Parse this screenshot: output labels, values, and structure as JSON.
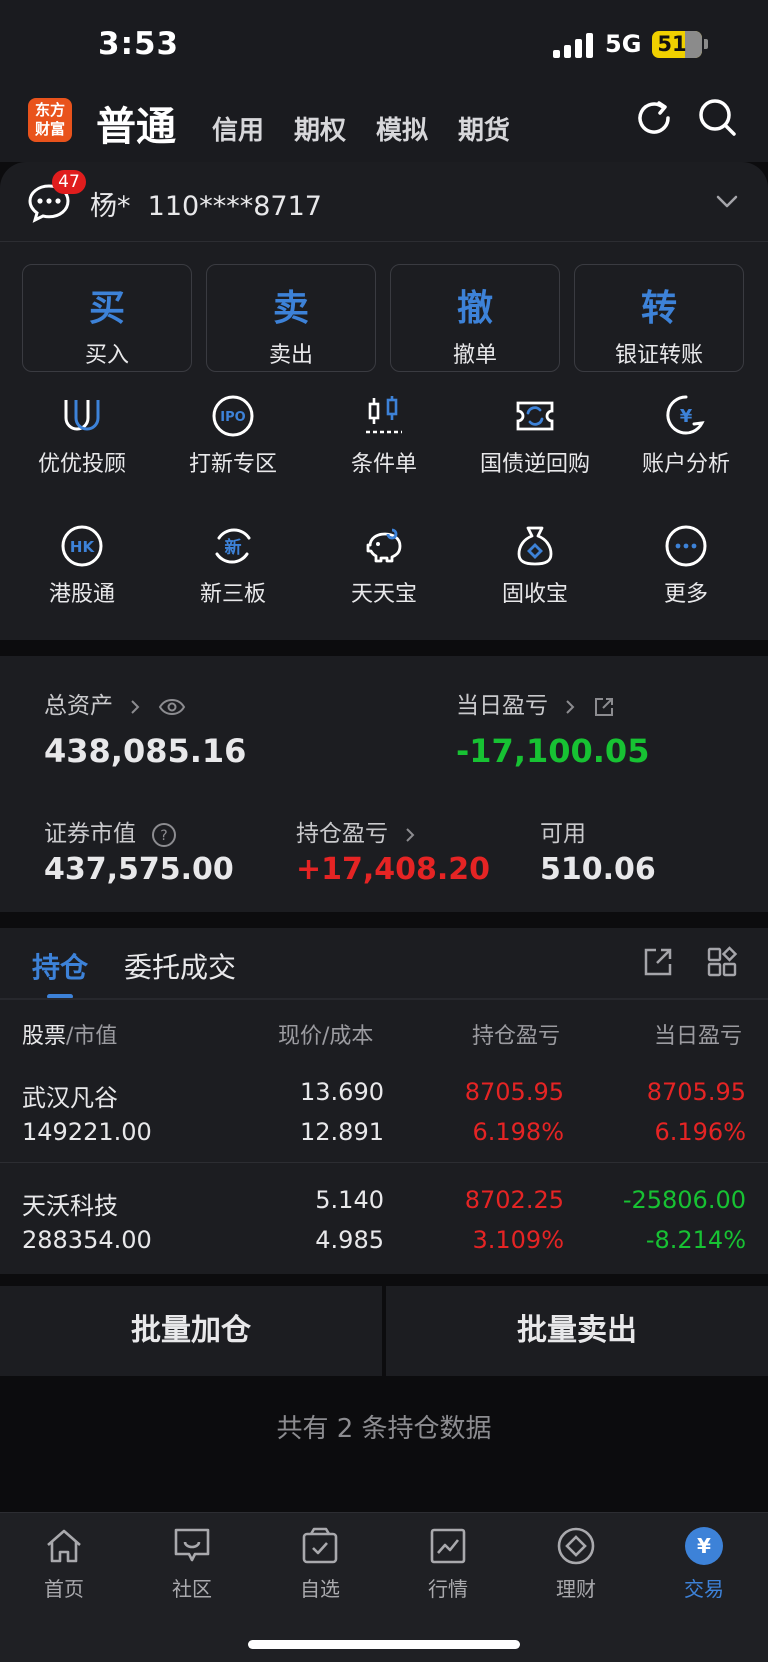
{
  "status": {
    "time": "3:53",
    "network": "5G",
    "battery": "51"
  },
  "header": {
    "logo": [
      "东方",
      "财富"
    ],
    "active_tab": "普通",
    "tabs": [
      "信用",
      "期权",
      "模拟",
      "期货"
    ]
  },
  "account": {
    "unread": "47",
    "name": "杨*",
    "number": "110****8717"
  },
  "trade_buttons": [
    {
      "big": "买",
      "small": "买入"
    },
    {
      "big": "卖",
      "small": "卖出"
    },
    {
      "big": "撤",
      "small": "撤单"
    },
    {
      "big": "转",
      "small": "银证转账"
    }
  ],
  "services": [
    {
      "label": "优优投顾",
      "icon": "youyou-icon"
    },
    {
      "label": "打新专区",
      "icon": "ipo-icon",
      "glyph": "IPO"
    },
    {
      "label": "条件单",
      "icon": "condition-order-icon"
    },
    {
      "label": "国债逆回购",
      "icon": "repo-icon"
    },
    {
      "label": "账户分析",
      "icon": "account-analysis-icon",
      "glyph": "¥"
    },
    {
      "label": "港股通",
      "icon": "hk-icon",
      "glyph": "HK"
    },
    {
      "label": "新三板",
      "icon": "neeq-icon",
      "glyph": "新"
    },
    {
      "label": "天天宝",
      "icon": "piggy-bank-icon"
    },
    {
      "label": "固收宝",
      "icon": "money-bag-icon"
    },
    {
      "label": "更多",
      "icon": "more-icon"
    }
  ],
  "assets": {
    "total_label": "总资产",
    "total_value": "438,085.16",
    "daily_label": "当日盈亏",
    "daily_value": "-17,100.05",
    "market_label": "证券市值",
    "market_value": "437,575.00",
    "holding_label": "持仓盈亏",
    "holding_value": "+17,408.20",
    "available_label": "可用",
    "available_value": "510.06"
  },
  "positions": {
    "tabs": [
      "持仓",
      "委托成交"
    ],
    "headers": {
      "stock": "股票",
      "stock_sub": "/市值",
      "price": "现价",
      "price_sub": "/成本",
      "pnl": "持仓盈亏",
      "daily": "当日盈亏"
    },
    "rows": [
      {
        "name": "武汉凡谷",
        "market_value": "149221.00",
        "price": "13.690",
        "cost": "12.891",
        "pnl": "8705.95",
        "pnl_pct": "6.198%",
        "daily": "8705.95",
        "daily_pct": "6.196%"
      },
      {
        "name": "天沃科技",
        "market_value": "288354.00",
        "price": "5.140",
        "cost": "4.985",
        "pnl": "8702.25",
        "pnl_pct": "3.109%",
        "daily": "-25806.00",
        "daily_pct": "-8.214%"
      }
    ]
  },
  "batch": {
    "add": "批量加仓",
    "sell": "批量卖出"
  },
  "summary": "共有 2 条持仓数据",
  "nav": [
    {
      "label": "首页",
      "icon": "home-icon"
    },
    {
      "label": "社区",
      "icon": "community-icon"
    },
    {
      "label": "自选",
      "icon": "watchlist-icon"
    },
    {
      "label": "行情",
      "icon": "market-icon"
    },
    {
      "label": "理财",
      "icon": "wealth-icon"
    },
    {
      "label": "交易",
      "icon": "trade-icon",
      "glyph": "¥"
    }
  ],
  "colors": {
    "accent": "#3d82d8",
    "up": "#e52424",
    "down": "#17c233",
    "logo": "#e9531c"
  }
}
